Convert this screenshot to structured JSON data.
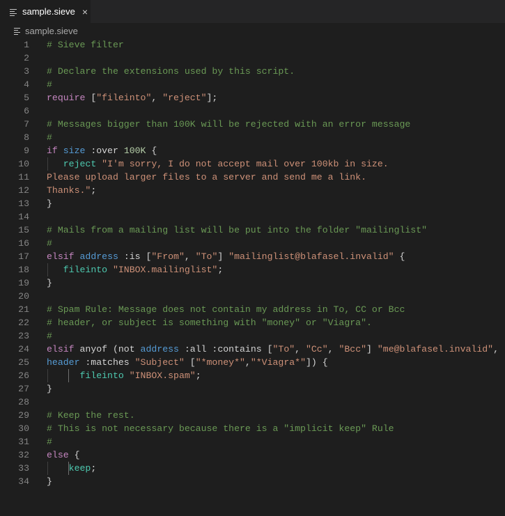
{
  "tab": {
    "title": "sample.sieve",
    "close_glyph": "×"
  },
  "breadcrumb": {
    "file": "sample.sieve"
  },
  "code_lines": [
    [
      [
        "c",
        "# Sieve filter"
      ]
    ],
    [],
    [
      [
        "c",
        "# Declare the extensions used by this script."
      ]
    ],
    [
      [
        "c",
        "#"
      ]
    ],
    [
      [
        "k",
        "require"
      ],
      [
        "p",
        " ["
      ],
      [
        "s",
        "\"fileinto\""
      ],
      [
        "p",
        ", "
      ],
      [
        "s",
        "\"reject\""
      ],
      [
        "p",
        "];"
      ]
    ],
    [],
    [
      [
        "c",
        "# Messages bigger than 100K will be rejected with an error message"
      ]
    ],
    [
      [
        "c",
        "#"
      ]
    ],
    [
      [
        "k",
        "if"
      ],
      [
        "p",
        " "
      ],
      [
        "t",
        "size"
      ],
      [
        "p",
        " :over "
      ],
      [
        "n",
        "100K"
      ],
      [
        "p",
        " {"
      ]
    ],
    [
      [
        "p",
        "   "
      ],
      [
        "f",
        "reject"
      ],
      [
        "p",
        " "
      ],
      [
        "s",
        "\"I'm sorry, I do not accept mail over 100kb in size."
      ]
    ],
    [
      [
        "s",
        "Please upload larger files to a server and send me a link."
      ]
    ],
    [
      [
        "s",
        "Thanks.\""
      ],
      [
        "p",
        ";"
      ]
    ],
    [
      [
        "p",
        "}"
      ]
    ],
    [],
    [
      [
        "c",
        "# Mails from a mailing list will be put into the folder \"mailinglist\""
      ]
    ],
    [
      [
        "c",
        "#"
      ]
    ],
    [
      [
        "k",
        "elsif"
      ],
      [
        "p",
        " "
      ],
      [
        "t",
        "address"
      ],
      [
        "p",
        " :is ["
      ],
      [
        "s",
        "\"From\""
      ],
      [
        "p",
        ", "
      ],
      [
        "s",
        "\"To\""
      ],
      [
        "p",
        "] "
      ],
      [
        "s",
        "\"mailinglist@blafasel.invalid\""
      ],
      [
        "p",
        " {"
      ]
    ],
    [
      [
        "p",
        "   "
      ],
      [
        "f",
        "fileinto"
      ],
      [
        "p",
        " "
      ],
      [
        "s",
        "\"INBOX.mailinglist\""
      ],
      [
        "p",
        ";"
      ]
    ],
    [
      [
        "p",
        "}"
      ]
    ],
    [],
    [
      [
        "c",
        "# Spam Rule: Message does not contain my address in To, CC or Bcc"
      ]
    ],
    [
      [
        "c",
        "# header, or subject is something with \"money\" or \"Viagra\"."
      ]
    ],
    [
      [
        "c",
        "#"
      ]
    ],
    [
      [
        "k",
        "elsif"
      ],
      [
        "p",
        " anyof (not "
      ],
      [
        "t",
        "address"
      ],
      [
        "p",
        " :all :contains ["
      ],
      [
        "s",
        "\"To\""
      ],
      [
        "p",
        ", "
      ],
      [
        "s",
        "\"Cc\""
      ],
      [
        "p",
        ", "
      ],
      [
        "s",
        "\"Bcc\""
      ],
      [
        "p",
        "] "
      ],
      [
        "s",
        "\"me@blafasel.invalid\""
      ],
      [
        "p",
        ","
      ]
    ],
    [
      [
        "t",
        "header"
      ],
      [
        "p",
        " :matches "
      ],
      [
        "s",
        "\"Subject\""
      ],
      [
        "p",
        " ["
      ],
      [
        "s",
        "\"*money*\""
      ],
      [
        "p",
        ","
      ],
      [
        "s",
        "\"*Viagra*\""
      ],
      [
        "p",
        "]) {"
      ]
    ],
    [
      [
        "p",
        "      "
      ],
      [
        "f",
        "fileinto"
      ],
      [
        "p",
        " "
      ],
      [
        "s",
        "\"INBOX.spam\""
      ],
      [
        "p",
        ";"
      ]
    ],
    [
      [
        "p",
        "}"
      ]
    ],
    [],
    [
      [
        "c",
        "# Keep the rest."
      ]
    ],
    [
      [
        "c",
        "# This is not necessary because there is a \"implicit keep\" Rule"
      ]
    ],
    [
      [
        "c",
        "#"
      ]
    ],
    [
      [
        "k",
        "else"
      ],
      [
        "p",
        " {"
      ]
    ],
    [
      [
        "p",
        "    "
      ],
      [
        "f",
        "keep"
      ],
      [
        "p",
        ";"
      ]
    ],
    [
      [
        "p",
        "}"
      ]
    ]
  ],
  "colors": {
    "background": "#1e1e1e",
    "comment": "#6a9955",
    "keyword": "#c586c0",
    "string": "#ce9178",
    "test": "#569cd6",
    "action": "#4ec9b0",
    "number": "#b5cea8",
    "line_number": "#858585"
  },
  "icons": {
    "tab": "file-lines-icon",
    "breadcrumb": "file-lines-icon",
    "close": "close-icon"
  }
}
